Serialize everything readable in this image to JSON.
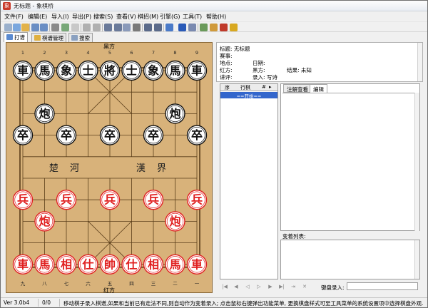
{
  "window": {
    "title": "无标题 - 象棋桥"
  },
  "menu": [
    "文件(F)",
    "编辑(E)",
    "导入(I)",
    "导出(P)",
    "搜索(S)",
    "查看(V)",
    "棋招(M)",
    "引擎(G)",
    "工具(T)",
    "帮助(H)"
  ],
  "toolbar": {
    "icons": [
      "new-icon",
      "open-icon",
      "open-folder-icon",
      "save-icon",
      "save-as-icon",
      "print-icon",
      "recycle-icon",
      "delete-icon",
      "back-icon",
      "forward-icon",
      "cut-icon",
      "copy-icon",
      "paste-icon",
      "close-icon",
      "swap-icon",
      "rotate-icon",
      "board-icon",
      "engine-icon",
      "search-icon",
      "tag-icon",
      "refresh-icon",
      "export-icon",
      "help-icon"
    ]
  },
  "tabs": [
    {
      "label": "打谱",
      "active": true
    },
    {
      "label": "棋谱管理",
      "active": false
    },
    {
      "label": "搜索",
      "active": false
    }
  ],
  "board": {
    "top_label": "黑方",
    "bottom_label": "红方",
    "top_numbers": [
      "1",
      "2",
      "3",
      "4",
      "5",
      "6",
      "7",
      "8",
      "9"
    ],
    "bottom_numbers": [
      "九",
      "八",
      "七",
      "六",
      "五",
      "四",
      "三",
      "二",
      "一"
    ],
    "river_left": "楚 河",
    "river_right": "漢 界",
    "black_pieces": [
      {
        "char": "車",
        "col": 0,
        "row": 0
      },
      {
        "char": "馬",
        "col": 1,
        "row": 0
      },
      {
        "char": "象",
        "col": 2,
        "row": 0
      },
      {
        "char": "士",
        "col": 3,
        "row": 0
      },
      {
        "char": "將",
        "col": 4,
        "row": 0
      },
      {
        "char": "士",
        "col": 5,
        "row": 0
      },
      {
        "char": "象",
        "col": 6,
        "row": 0
      },
      {
        "char": "馬",
        "col": 7,
        "row": 0
      },
      {
        "char": "車",
        "col": 8,
        "row": 0
      },
      {
        "char": "炮",
        "col": 1,
        "row": 2
      },
      {
        "char": "炮",
        "col": 7,
        "row": 2
      },
      {
        "char": "卒",
        "col": 0,
        "row": 3
      },
      {
        "char": "卒",
        "col": 2,
        "row": 3
      },
      {
        "char": "卒",
        "col": 4,
        "row": 3
      },
      {
        "char": "卒",
        "col": 6,
        "row": 3
      },
      {
        "char": "卒",
        "col": 8,
        "row": 3
      }
    ],
    "red_pieces": [
      {
        "char": "兵",
        "col": 0,
        "row": 6
      },
      {
        "char": "兵",
        "col": 2,
        "row": 6
      },
      {
        "char": "兵",
        "col": 4,
        "row": 6
      },
      {
        "char": "兵",
        "col": 6,
        "row": 6
      },
      {
        "char": "兵",
        "col": 8,
        "row": 6
      },
      {
        "char": "炮",
        "col": 1,
        "row": 7
      },
      {
        "char": "炮",
        "col": 7,
        "row": 7
      },
      {
        "char": "車",
        "col": 0,
        "row": 9
      },
      {
        "char": "馬",
        "col": 1,
        "row": 9
      },
      {
        "char": "相",
        "col": 2,
        "row": 9
      },
      {
        "char": "仕",
        "col": 3,
        "row": 9
      },
      {
        "char": "帥",
        "col": 4,
        "row": 9
      },
      {
        "char": "仕",
        "col": 5,
        "row": 9
      },
      {
        "char": "相",
        "col": 6,
        "row": 9
      },
      {
        "char": "馬",
        "col": 7,
        "row": 9
      },
      {
        "char": "車",
        "col": 8,
        "row": 9
      }
    ],
    "colors": {
      "board_bg": "#d8b27a",
      "line": "#5a3e1a",
      "red": "#e02020",
      "black": "#111111",
      "piece_bg": "#ffffff"
    }
  },
  "info": {
    "title": "标题: 无标题",
    "event": "赛事:",
    "place": "地点:",
    "date": "日期:",
    "red": "红方:",
    "black": "黑方:",
    "result": "结果: 未知",
    "commentator": "讲评:",
    "recorder": "录入: 写诗"
  },
  "movelist": {
    "col_seq": "序",
    "col_move": "行棋",
    "col_mark": "#",
    "first_row": "==开始=="
  },
  "notes": {
    "tab_comment": "注解查看",
    "tab_edit": "编辑",
    "variations_label": "变着列表:"
  },
  "navigation": {
    "keyboard_label": "键盘录入:"
  },
  "status": {
    "version": "Ver 3.0b4",
    "position": "0/0",
    "hint": "移动棋子录入棋谱,如果和当前已有走法不同,则自动作为变着录入; 点击鼠标右键弹出功能菜单, 更换棋盘样式可至工具菜单的系统设置项中选择棋盘外观."
  }
}
